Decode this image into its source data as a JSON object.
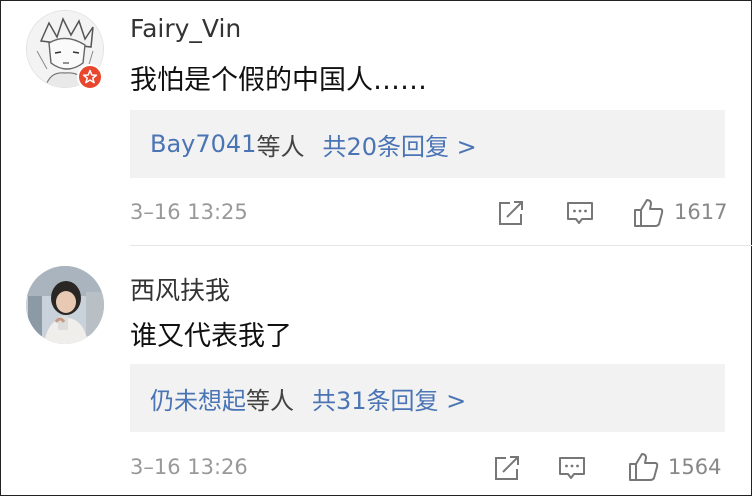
{
  "comments": [
    {
      "username": "Fairy_Vin",
      "text": "我怕是个假的中国人……",
      "reply_names": "Bay7041",
      "reply_etc": "等人",
      "reply_count": "共20条回复 >",
      "time": "3–16 13:25",
      "likes": "1617",
      "verified_badge": true
    },
    {
      "username": "西风扶我",
      "text": "谁又代表我了",
      "reply_names": "仍未想起",
      "reply_etc": "等人",
      "reply_count": "共31条回复 >",
      "time": "3–16 13:26",
      "likes": "1564"
    }
  ],
  "icons": {
    "share": "share-icon",
    "comment": "comment-icon",
    "like": "thumbs-up-icon",
    "badge": "verified-star-icon"
  },
  "colors": {
    "link": "#4a74b4",
    "badge": "#e8462d",
    "reply_bg": "#f2f2f2",
    "meta": "#999999"
  }
}
